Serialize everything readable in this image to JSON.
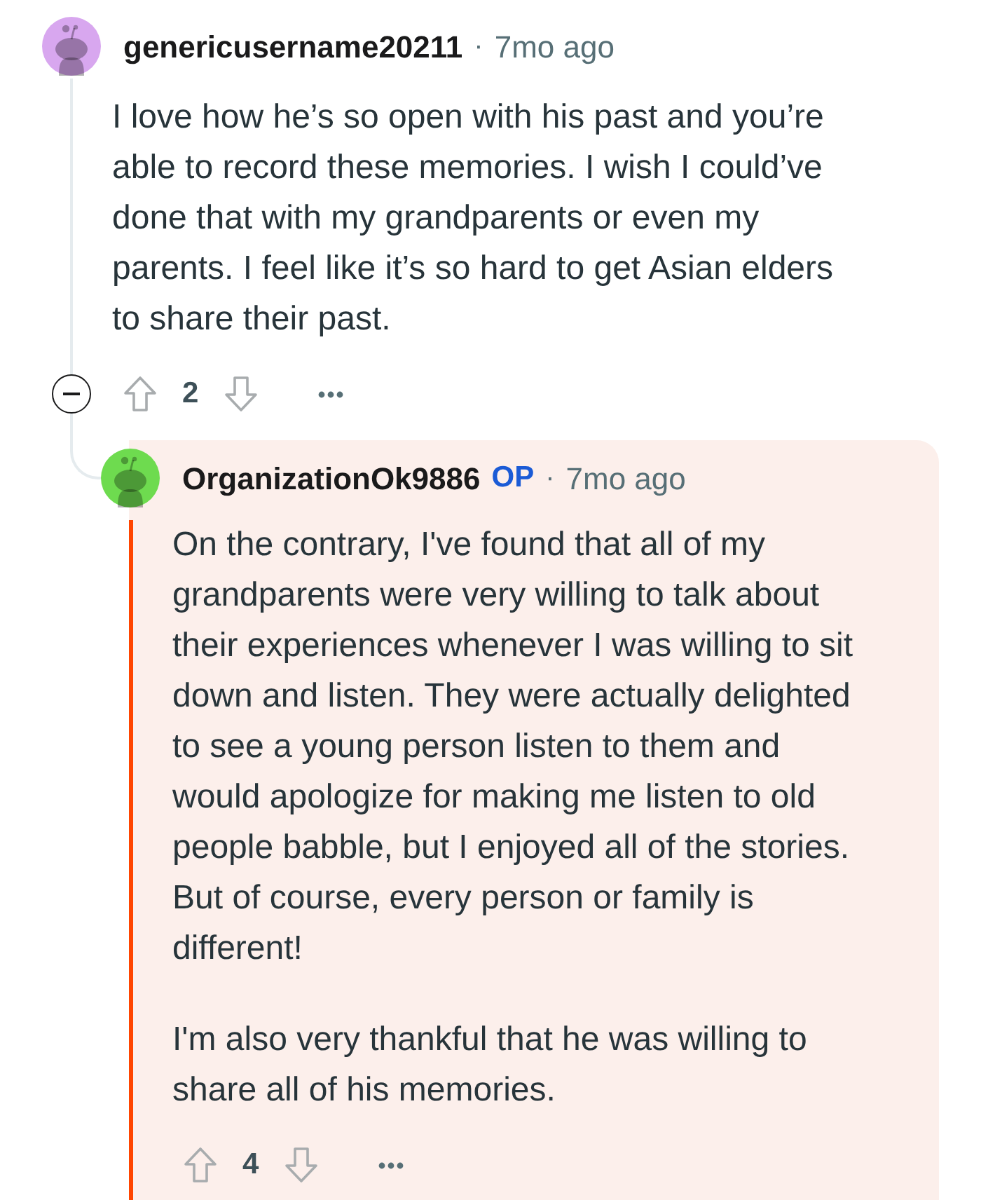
{
  "comment": {
    "author": "genericusername20211",
    "separator": "·",
    "time": "7mo ago",
    "paragraphs": [
      "I love how he’s so open with his past and you’re able to record these memories. I wish I could’ve done that with my grandparents or even my parents. I feel like it’s so hard to get Asian elders to share their past."
    ],
    "expanded": true,
    "score": "2",
    "replies": [
      {
        "author": "OrganizationOk9886",
        "badge": "OP",
        "separator": "·",
        "time": "7mo ago",
        "highlighted": true,
        "paragraphs": [
          "On the contrary, I've found that all of my grandparents were very willing to talk about their experiences whenever I was willing to sit down and listen. They were actually delighted to see a young person listen to them and would apologize for making me listen to old people babble, but I enjoyed all of the stories. But of course, every person or family is different!",
          "I'm also very thankful that he was willing to share all of his memories."
        ],
        "score": "4"
      }
    ]
  }
}
